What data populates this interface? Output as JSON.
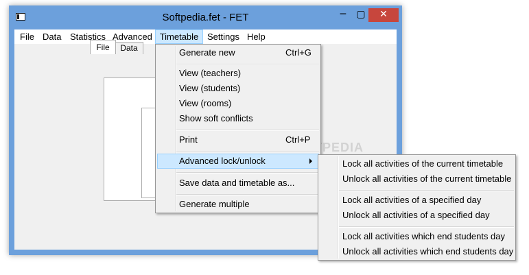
{
  "window": {
    "title": "Softpedia.fet - FET",
    "close_glyph": "✕",
    "minimize_glyph": "─",
    "maximize_glyph": "▢"
  },
  "menubar": {
    "items": [
      {
        "label": "File"
      },
      {
        "label": "Data"
      },
      {
        "label": "Statistics"
      },
      {
        "label": "Advanced"
      },
      {
        "label": "Timetable"
      },
      {
        "label": "Settings"
      },
      {
        "label": "Help"
      }
    ]
  },
  "tabs": {
    "file": "File",
    "data": "Data"
  },
  "timetable_menu": {
    "generate_new": {
      "label": "Generate new",
      "shortcut": "Ctrl+G"
    },
    "view_teachers": "View (teachers)",
    "view_students": "View (students)",
    "view_rooms": "View (rooms)",
    "show_soft_conflicts": "Show soft conflicts",
    "print": {
      "label": "Print",
      "shortcut": "Ctrl+P"
    },
    "advanced_lock": "Advanced lock/unlock",
    "save_data": "Save data and timetable as...",
    "generate_multiple": "Generate multiple"
  },
  "lock_submenu": {
    "items": [
      "Lock all activities of the current timetable",
      "Unlock all activities of the current timetable",
      "Lock all activities of a specified day",
      "Unlock all activities of a specified day",
      "Lock all activities which end students day",
      "Unlock all activities which end students day"
    ]
  },
  "watermark": "SOFTPEDIA",
  "colors": {
    "titlebar": "#6ca0dc",
    "close_button": "#c7463d",
    "menu_highlight": "#cce8ff"
  }
}
